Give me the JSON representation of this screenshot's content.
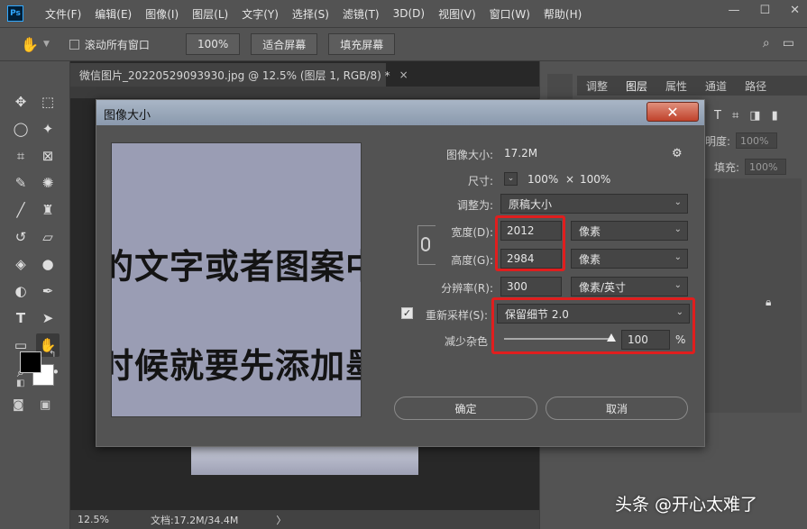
{
  "app": {
    "logo": "Ps",
    "menu": [
      "文件(F)",
      "编辑(E)",
      "图像(I)",
      "图层(L)",
      "文字(Y)",
      "选择(S)",
      "滤镜(T)",
      "3D(D)",
      "视图(V)",
      "窗口(W)",
      "帮助(H)"
    ],
    "window_controls": {
      "minimize": "—",
      "maximize": "☐",
      "close": "✕"
    }
  },
  "options_bar": {
    "scroll_all_label": "滚动所有窗口",
    "zoom_value": "100%",
    "fit_screen": "适合屏幕",
    "fill_screen": "填充屏幕"
  },
  "document": {
    "tab_title": "微信图片_20220529093930.jpg @ 12.5% (图层 1, RGB/8) *",
    "tab_close": "×",
    "status_zoom": "12.5%",
    "status_doc": "文档:17.2M/34.4M",
    "status_arrow": "〉"
  },
  "right_panel": {
    "tabs": [
      "调整",
      "图层",
      "属性",
      "通道",
      "路径"
    ],
    "active_tab": "图层",
    "opacity_label": "透明度:",
    "opacity_value": "100%",
    "fill_label": "填充:",
    "fill_value": "100%"
  },
  "dialog": {
    "title": "图像大小",
    "close": "✕",
    "preview_lines": [
      "的文字或者图案中的",
      "时候就要先添加墨"
    ],
    "image_size_label": "图像大小:",
    "image_size_value": "17.2M",
    "gear": "⚙",
    "dimensions_label": "尺寸:",
    "dimensions_w": "100%",
    "dimensions_x": "×",
    "dimensions_h": "100%",
    "fit_to_label": "调整为:",
    "fit_to_value": "原稿大小",
    "width_label": "宽度(D):",
    "width_value": "2012",
    "width_unit": "像素",
    "height_label": "高度(G):",
    "height_value": "2984",
    "height_unit": "像素",
    "resolution_label": "分辨率(R):",
    "resolution_value": "300",
    "resolution_unit": "像素/英寸",
    "resample_label": "重新采样(S):",
    "resample_checked": true,
    "resample_value": "保留细节 2.0",
    "noise_label": "减少杂色",
    "noise_value": "100",
    "noise_unit": "%",
    "ok": "确定",
    "cancel": "取消"
  },
  "watermark": "头条 @开心太难了",
  "colors": {
    "highlight": "#e01e1e",
    "foreground": "#000000",
    "background": "#ffffff"
  }
}
